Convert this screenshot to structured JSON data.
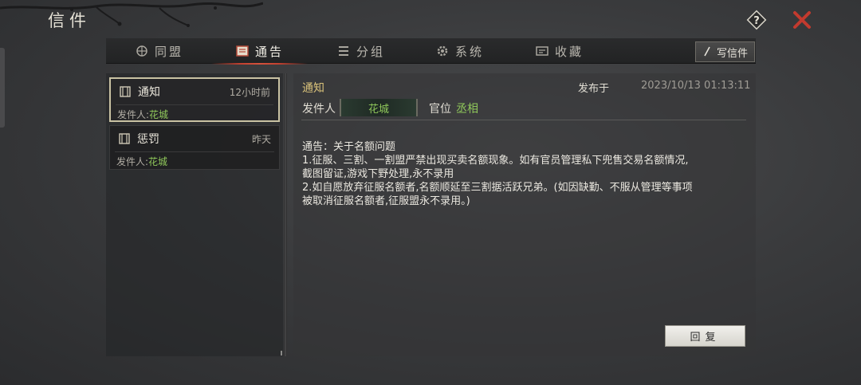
{
  "window": {
    "title": "信件"
  },
  "header": {
    "help_icon": "help-icon",
    "close_icon": "close-icon",
    "accent": "#c23a2e"
  },
  "tabs": [
    {
      "label": "同盟",
      "icon": "alliance-icon",
      "active": false
    },
    {
      "label": "通告",
      "icon": "notice-icon",
      "active": true
    },
    {
      "label": "分组",
      "icon": "group-icon",
      "active": false
    },
    {
      "label": "系统",
      "icon": "system-gear-icon",
      "active": false
    },
    {
      "label": "收藏",
      "icon": "favorite-icon",
      "active": false
    }
  ],
  "write_button": {
    "label": "写信件",
    "icon": "pen-icon"
  },
  "mail_list": [
    {
      "subject": "通知",
      "time": "12小时前",
      "sender_prefix": "发件人:",
      "sender": "花城",
      "selected": true
    },
    {
      "subject": "惩罚",
      "time": "昨天",
      "sender_prefix": "发件人:",
      "sender": "花城",
      "selected": false
    }
  ],
  "detail": {
    "title": "通知",
    "published_label": "发布于",
    "published_time": "2023/10/13 01:13:11",
    "sender_label": "发件人",
    "sender": "花城",
    "rank_label": "官位",
    "rank": "丞相",
    "body_lines": [
      "通告：关于名额问题",
      "1.征服、三割、一割盟严禁出现买卖名额现象。如有官员管理私下兜售交易名额情况,",
      "截图留证,游戏下野处理,永不录用",
      "2.如自愿放弃征服名额者,名额顺延至三割据活跃兄弟。(如因缺勤、不服从管理等事项",
      "被取消征服名额者,征服盟永不录用。)"
    ],
    "reply_label": "回复"
  },
  "colors": {
    "green_name": "#8fc75a",
    "gold_title": "#d9c27a"
  }
}
